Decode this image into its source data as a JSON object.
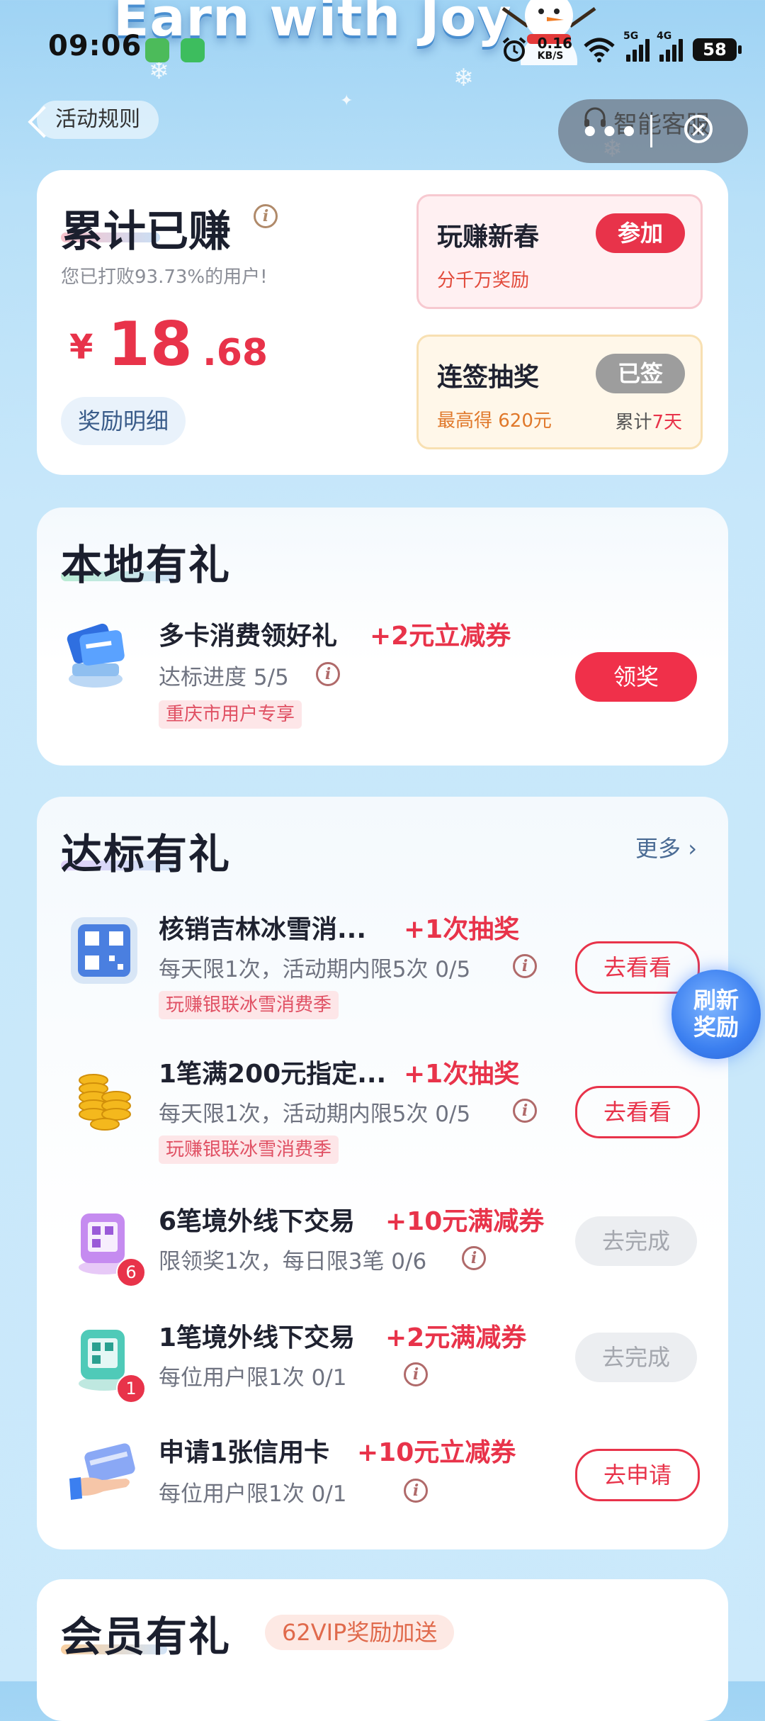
{
  "status_bar": {
    "time": "09:06",
    "net_speed": "0.16",
    "net_unit": "KB/S",
    "sig1": "5G",
    "sig2": "4G",
    "battery": "58"
  },
  "hero": {
    "title": "Earn with Joy"
  },
  "top": {
    "rules_label": "活动规则",
    "service_label": "智能客服",
    "service_dots": "•••",
    "close_glyph": "✕"
  },
  "earnings": {
    "title": "累计已赚",
    "beat_text": "您已打败93.73%的用户!",
    "currency": "¥",
    "amount_int": "18",
    "amount_dec": ".68",
    "detail_label": "奖励明细",
    "promo1": {
      "title": "玩赚新春",
      "subtitle": "分千万奖励",
      "button": "参加"
    },
    "promo2": {
      "title": "连签抽奖",
      "subtitle": "最高得 620元",
      "button": "已签",
      "cumul_prefix": "累计",
      "cumul_days": "7天"
    }
  },
  "local": {
    "title": "本地有礼",
    "task": {
      "title": "多卡消费领好礼",
      "reward": "+2元立减券",
      "progress": "达标进度  5/5",
      "tag": "重庆市用户专享",
      "button": "领奖"
    }
  },
  "standard": {
    "title": "达标有礼",
    "more": "更多 ›",
    "tasks": [
      {
        "title": "核销吉林冰雪消...",
        "reward": "+1次抽奖",
        "sub": "每天限1次，活动期内限5次  0/5",
        "tag": "玩赚银联冰雪消费季",
        "button": "去看看"
      },
      {
        "title": "1笔满200元指定...",
        "reward": "+1次抽奖",
        "sub": "每天限1次，活动期内限5次  0/5",
        "tag": "玩赚银联冰雪消费季",
        "button": "去看看"
      },
      {
        "title": "6笔境外线下交易",
        "reward": "+10元满减券",
        "sub": "限领奖1次，每日限3笔  0/6",
        "badge": "6",
        "button": "去完成"
      },
      {
        "title": "1笔境外线下交易",
        "reward": "+2元满减券",
        "sub": "每位用户限1次  0/1",
        "badge": "1",
        "button": "去完成"
      },
      {
        "title": "申请1张信用卡",
        "reward": "+10元立减券",
        "sub": "每位用户限1次  0/1",
        "button": "去申请"
      }
    ]
  },
  "refresh": {
    "line1": "刷新",
    "line2": "奖励"
  },
  "member": {
    "title": "会员有礼",
    "tag": "62VIP奖励加送"
  },
  "colors": {
    "accent": "#e8334a",
    "link": "#4a6b94"
  },
  "icons": [
    "snowman-icon",
    "alarm-icon",
    "wifi-icon",
    "signal-icon",
    "battery-icon",
    "headset-icon",
    "close-icon",
    "info-icon",
    "cards-icon",
    "qr-code-icon",
    "coins-icon",
    "qr-stand-icon",
    "credit-card-hand-icon",
    "chevron-right-icon"
  ]
}
